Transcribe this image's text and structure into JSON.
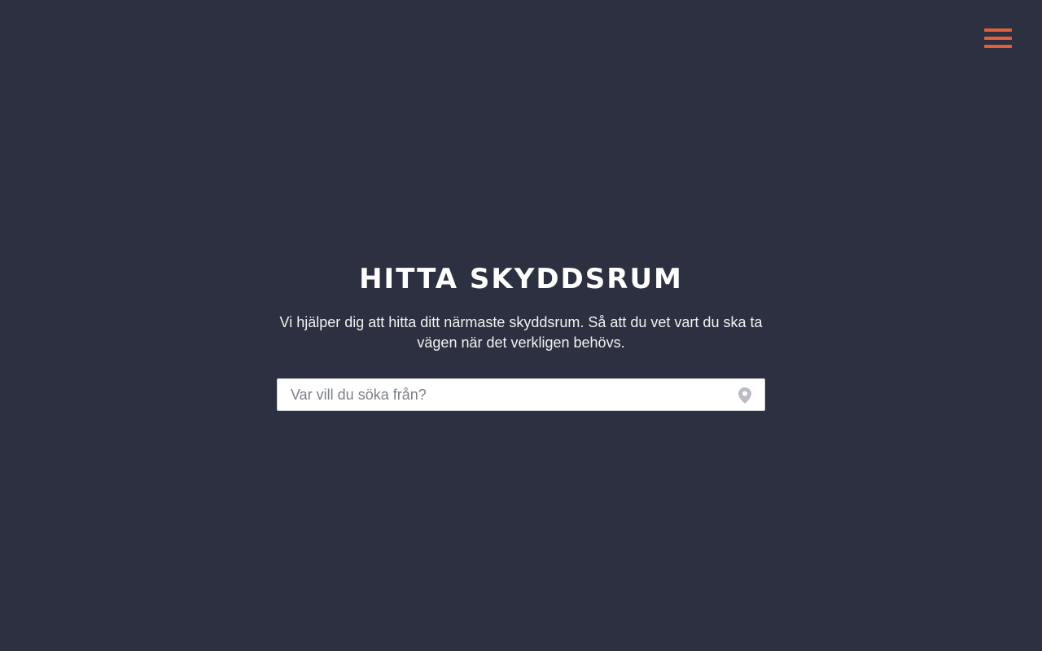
{
  "header": {
    "menu_icon": "hamburger-menu-icon",
    "menu_color": "#e0603a"
  },
  "hero": {
    "title": "HITTA SKYDDSRUM",
    "subtitle": "Vi hjälper dig att hitta ditt närmaste skyddsrum. Så att du vet vart du ska ta vägen när det verkligen behövs."
  },
  "search": {
    "placeholder": "Var vill du söka från?",
    "value": "",
    "location_icon": "location-pin-icon"
  },
  "colors": {
    "background": "#2c3040",
    "accent": "#e0603a",
    "text": "#ffffff"
  }
}
